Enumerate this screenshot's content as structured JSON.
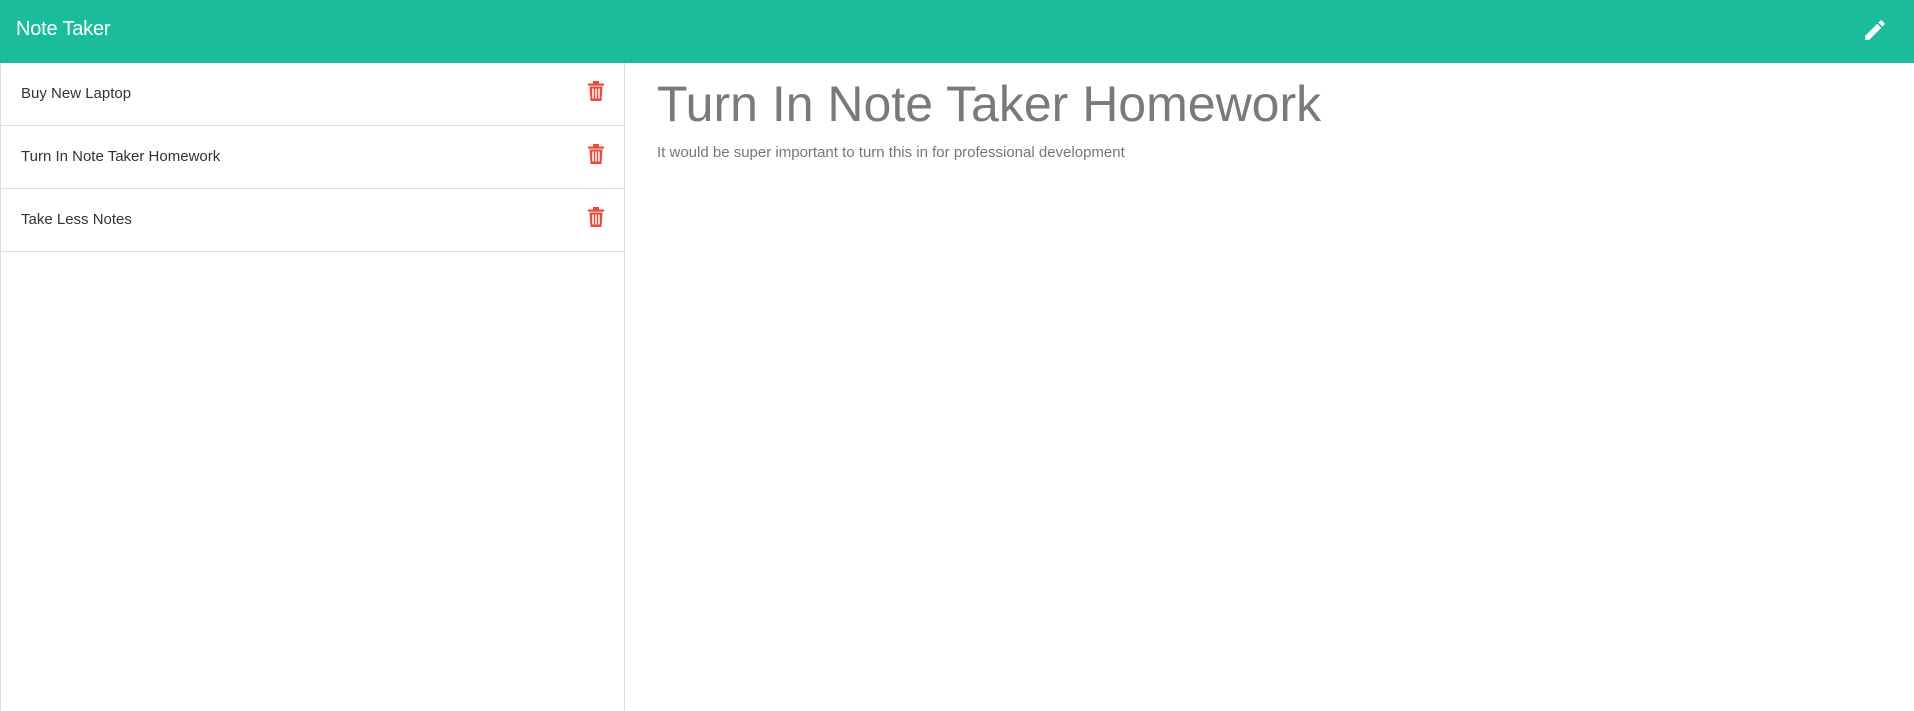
{
  "header": {
    "title": "Note Taker",
    "new_note_icon": "pencil-icon"
  },
  "sidebar": {
    "notes": [
      {
        "title": "Buy New Laptop",
        "delete_icon": "trash-icon"
      },
      {
        "title": "Turn In Note Taker Homework",
        "delete_icon": "trash-icon"
      },
      {
        "title": "Take Less Notes",
        "delete_icon": "trash-icon"
      }
    ]
  },
  "main": {
    "note_title": "Turn In Note Taker Homework",
    "note_text": "It would be super important to turn this in for professional development"
  },
  "colors": {
    "accent": "#1abc9c",
    "delete": "#e74c3c",
    "title_text": "#7a7a7a"
  }
}
